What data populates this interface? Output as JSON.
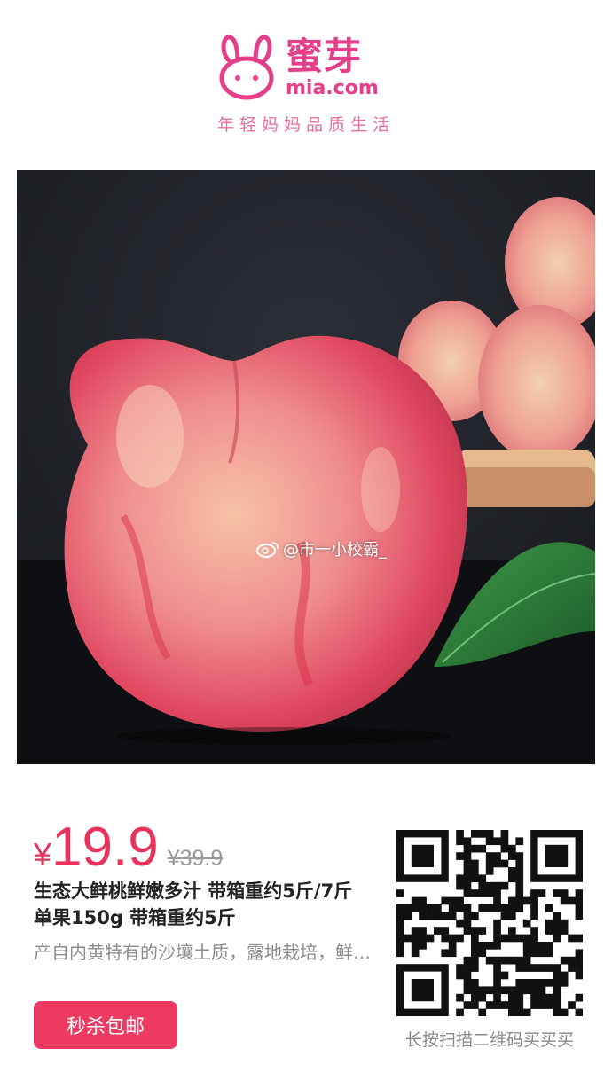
{
  "header": {
    "brand_cn": "蜜芽",
    "brand_en": "mia.com",
    "slogan": "年轻妈妈品质生活",
    "logo_icon": "bunny-icon",
    "brand_color": "#e43f8a"
  },
  "photo": {
    "subject": "peach",
    "watermark": "@市一小校霸_",
    "watermark_icon": "weibo-icon"
  },
  "product": {
    "currency": "¥",
    "price": "19.9",
    "original_price": "¥39.9",
    "title": "生态大鲜桃鲜嫩多汁 带箱重约5斤/7斤单果150g 带箱重约5斤",
    "description": "产自内黄特有的沙壤土质，露地栽培，鲜甜多汁",
    "price_color": "#e8325c"
  },
  "actions": {
    "buy_button": "秒杀包邮"
  },
  "qr": {
    "caption": "长按扫描二维码买买买",
    "icon": "qr-code-icon"
  }
}
